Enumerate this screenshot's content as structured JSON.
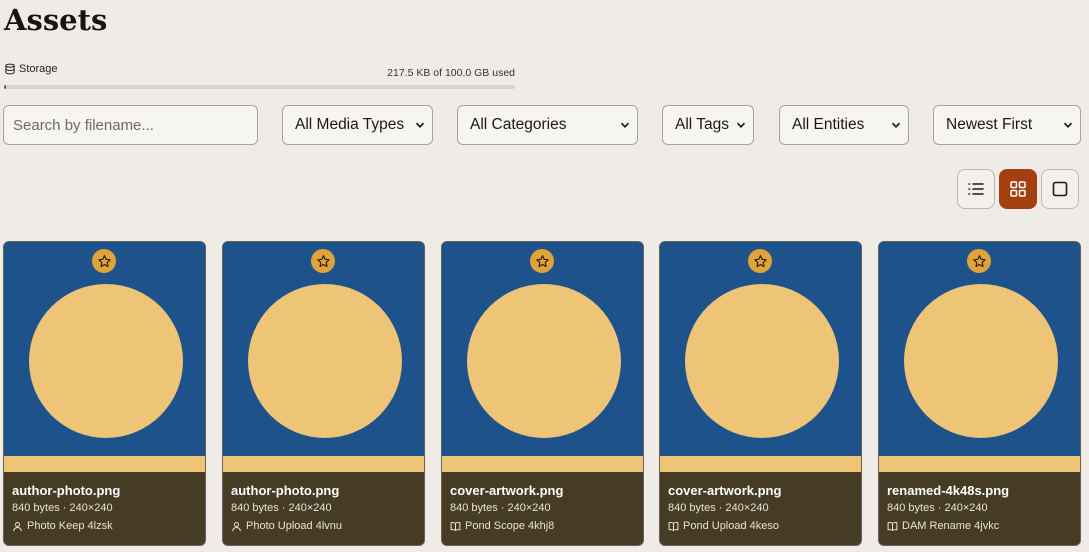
{
  "page": {
    "title": "Assets"
  },
  "storage": {
    "label": "Storage",
    "icon": "database-icon",
    "used_text": "217.5 KB of 100.0 GB used",
    "used_fraction": 2e-06
  },
  "filters": {
    "search_placeholder": "Search by filename...",
    "media_type": "All Media Types",
    "category": "All Categories",
    "tags": "All Tags",
    "entities": "All Entities",
    "sort": "Newest First"
  },
  "view_modes": [
    {
      "name": "list-view",
      "icon": "list-icon",
      "active": false
    },
    {
      "name": "grid-view",
      "icon": "grid-icon",
      "active": true
    },
    {
      "name": "large-view",
      "icon": "square-icon",
      "active": false
    }
  ],
  "assets": [
    {
      "filename": "author-photo.png",
      "details": "840 bytes · 240×240",
      "entity": "Photo Keep 4lzsk",
      "entity_icon": "person-icon"
    },
    {
      "filename": "author-photo.png",
      "details": "840 bytes · 240×240",
      "entity": "Photo Upload 4lvnu",
      "entity_icon": "person-icon"
    },
    {
      "filename": "cover-artwork.png",
      "details": "840 bytes · 240×240",
      "entity": "Pond Scope 4khj8",
      "entity_icon": "book-icon"
    },
    {
      "filename": "cover-artwork.png",
      "details": "840 bytes · 240×240",
      "entity": "Pond Upload 4keso",
      "entity_icon": "book-icon"
    },
    {
      "filename": "renamed-4k48s.png",
      "details": "840 bytes · 240×240",
      "entity": "DAM Rename 4jvkc",
      "entity_icon": "book-icon"
    }
  ],
  "colors": {
    "accent": "#a2400f",
    "thumb_bg": "#1e528b",
    "thumb_fg": "#eec576",
    "card_meta_bg": "#463b24",
    "star_bg": "#e0a33a"
  }
}
